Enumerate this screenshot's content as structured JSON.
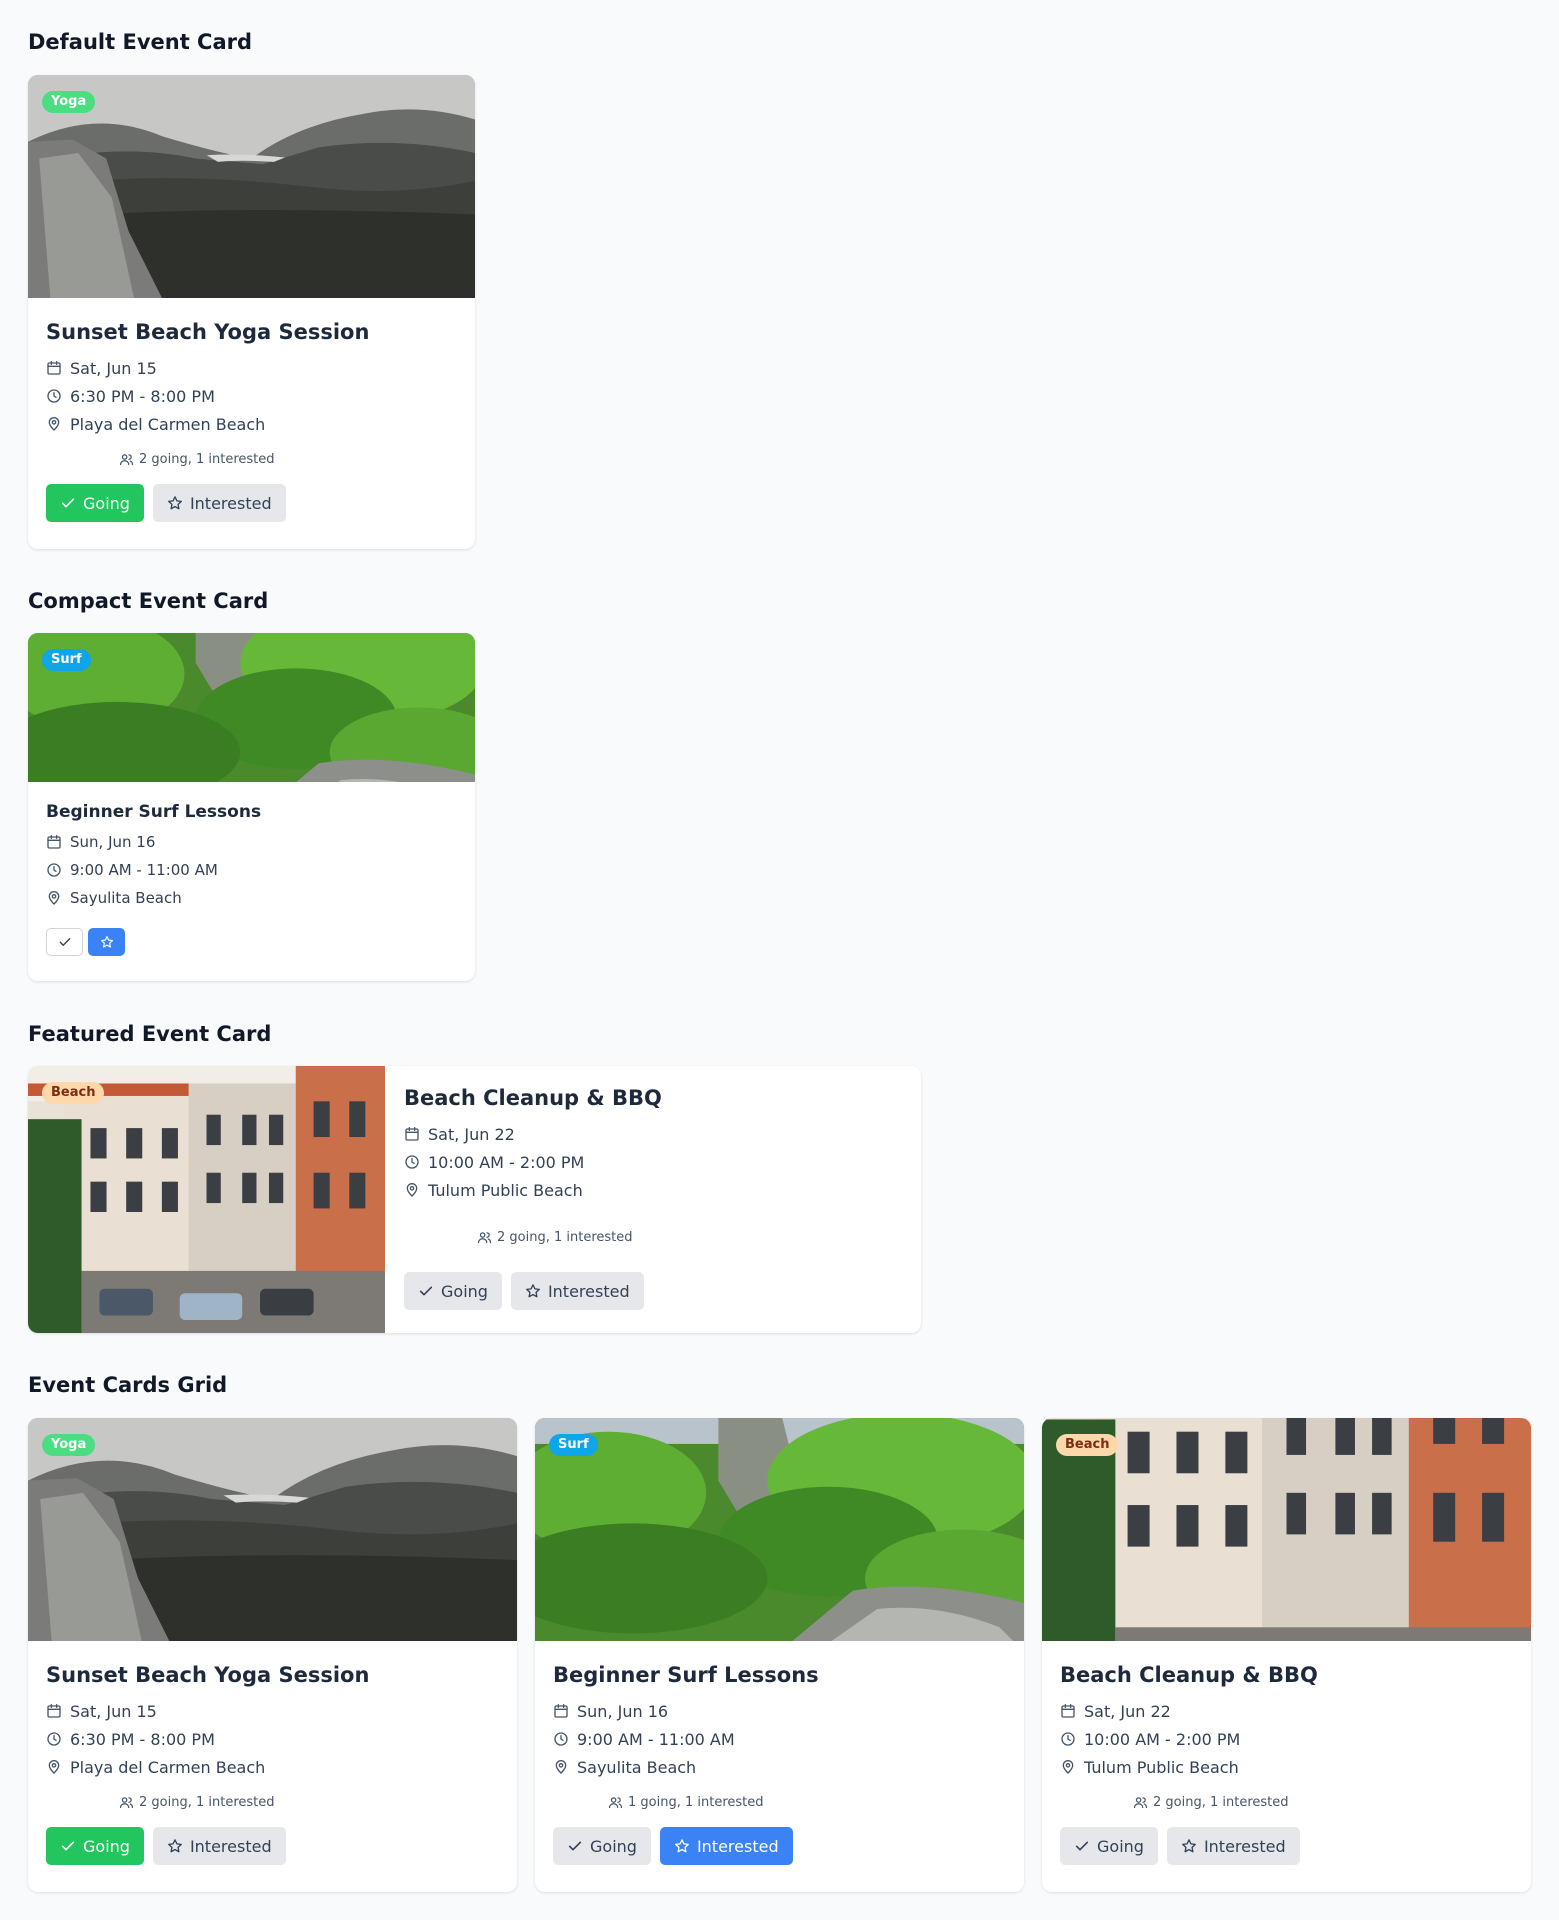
{
  "sections": {
    "default": "Default Event Card",
    "compact": "Compact Event Card",
    "featured": "Featured Event Card",
    "grid": "Event Cards Grid"
  },
  "events": {
    "yoga": {
      "category": "Yoga",
      "title": "Sunset Beach Yoga Session",
      "date": "Sat, Jun 15",
      "time": "6:30 PM - 8:00 PM",
      "location": "Playa del Carmen Beach",
      "stats": "2 going, 1 interested"
    },
    "surf": {
      "category": "Surf",
      "title": "Beginner Surf Lessons",
      "date": "Sun, Jun 16",
      "time": "9:00 AM - 11:00 AM",
      "location": "Sayulita Beach",
      "stats": "1 going, 1 interested"
    },
    "beach": {
      "category": "Beach",
      "title": "Beach Cleanup & BBQ",
      "date": "Sat, Jun 22",
      "time": "10:00 AM - 2:00 PM",
      "location": "Tulum Public Beach",
      "stats": "2 going, 1 interested"
    }
  },
  "buttons": {
    "going": "Going",
    "interested": "Interested"
  },
  "colors": {
    "going_active": "#22c55e",
    "interested_active": "#3b82f6",
    "button_idle": "#e5e7eb",
    "badge_yoga": "#4ade80",
    "badge_surf": "#0ea5e9",
    "badge_beach": "#fed7aa"
  },
  "icons": [
    "calendar-icon",
    "clock-icon",
    "map-pin-icon",
    "users-icon",
    "check-icon",
    "star-icon"
  ]
}
